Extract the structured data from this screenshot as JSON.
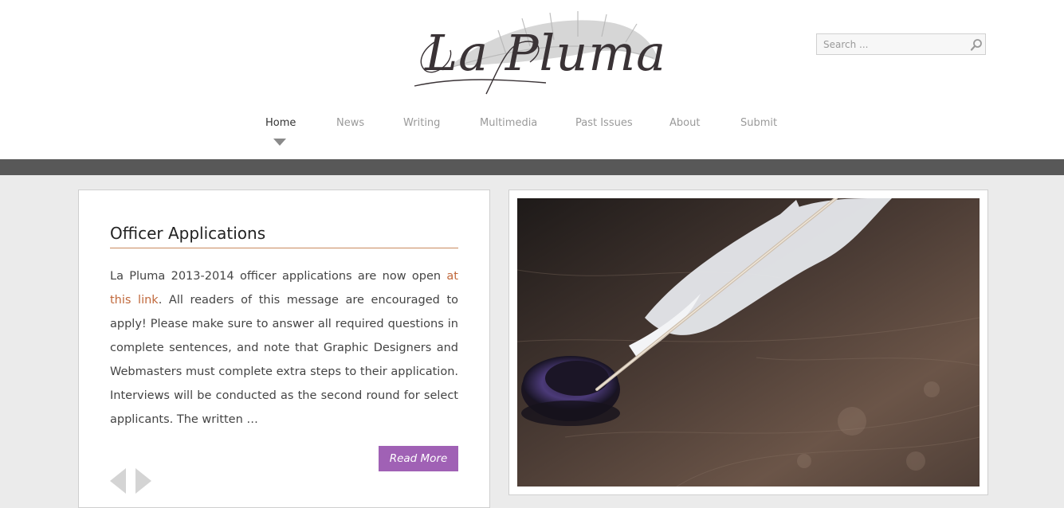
{
  "site": {
    "logo_text": "La Pluma"
  },
  "search": {
    "placeholder": "Search ..."
  },
  "nav": {
    "items": [
      {
        "label": "Home",
        "active": true
      },
      {
        "label": "News",
        "active": false
      },
      {
        "label": "Writing",
        "active": false
      },
      {
        "label": "Multimedia",
        "active": false
      },
      {
        "label": "Past Issues",
        "active": false
      },
      {
        "label": "About",
        "active": false
      },
      {
        "label": "Submit",
        "active": false
      }
    ]
  },
  "post": {
    "title": "Officer Applications",
    "body_start": "La Pluma 2013-2014 officer applications are now open ",
    "link_text": "at this link",
    "body_end": ". All readers of this message are encouraged to apply! Please make sure to answer all required questions in complete sentences, and note that Graphic Designers and Webmasters must complete extra steps to their application. Interviews will be conducted as the second round for select applicants. The written …",
    "read_more_label": "Read More"
  },
  "colors": {
    "accent_button": "#a061b5",
    "link": "#c0683b",
    "top_bar": "#585858",
    "page_background": "#ebebeb"
  },
  "icons": {
    "search": "magnifier-icon",
    "prev": "arrow-left-icon",
    "next": "arrow-right-icon",
    "nav_indicator": "caret-down-icon",
    "logo_feather": "feather-icon"
  }
}
